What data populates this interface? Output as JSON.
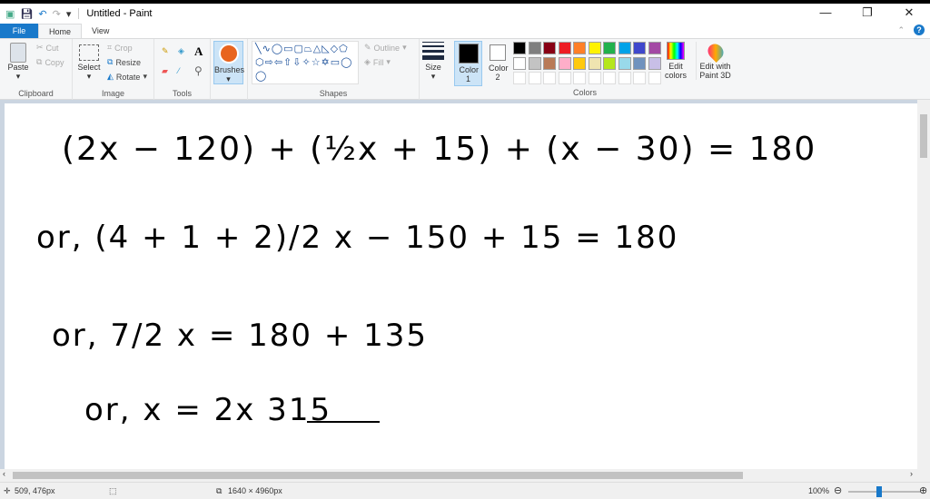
{
  "window": {
    "title": "Untitled - Paint",
    "minimize": "—",
    "restore": "❐",
    "close": "✕"
  },
  "tabs": [
    "File",
    "Home",
    "View"
  ],
  "help": "?",
  "ribbon": {
    "clipboard": {
      "paste": "Paste",
      "cut": "Cut",
      "copy": "Copy",
      "label": "Clipboard"
    },
    "image": {
      "select": "Select",
      "crop": "Crop",
      "resize": "Resize",
      "rotate": "Rotate",
      "label": "Image"
    },
    "tools": {
      "label": "Tools",
      "text_tool": "A"
    },
    "brushes": "Brushes",
    "shapes": {
      "outline": "Outline",
      "fill": "Fill",
      "label": "Shapes",
      "glyphs": "╲∿◯▭▢⏢△◺◇⬠⬡⇨⇦⇧⇩✧☆✡▭◯◯"
    },
    "size": "Size",
    "color1": "Color 1",
    "color1_value": "#000000",
    "color2": "Color 2",
    "color2_value": "#ffffff",
    "colors_label": "Colors",
    "palette": [
      "#000000",
      "#7f7f7f",
      "#880015",
      "#ed1c24",
      "#ff7f27",
      "#fff200",
      "#22b14c",
      "#00a2e8",
      "#3f48cc",
      "#a349a4",
      "#ffffff",
      "#c3c3c3",
      "#b97a57",
      "#ffaec9",
      "#ffc90e",
      "#efe4b0",
      "#b5e61d",
      "#99d9ea",
      "#7092be",
      "#c8bfe7"
    ],
    "edit_colors": "Edit colors",
    "paint3d": "Edit with Paint 3D"
  },
  "canvas": {
    "lines": [
      "(2x − 120) + (½x + 15) + (x − 30) = 180",
      "or, (4 + 1 + 2)/2 x − 150 + 15 = 180",
      "or, 7/2 x = 180 + 135",
      "or, x = 2x 315"
    ]
  },
  "status": {
    "cursor": "509, 476px",
    "size": "1640 × 4960px",
    "zoom": "100%"
  }
}
